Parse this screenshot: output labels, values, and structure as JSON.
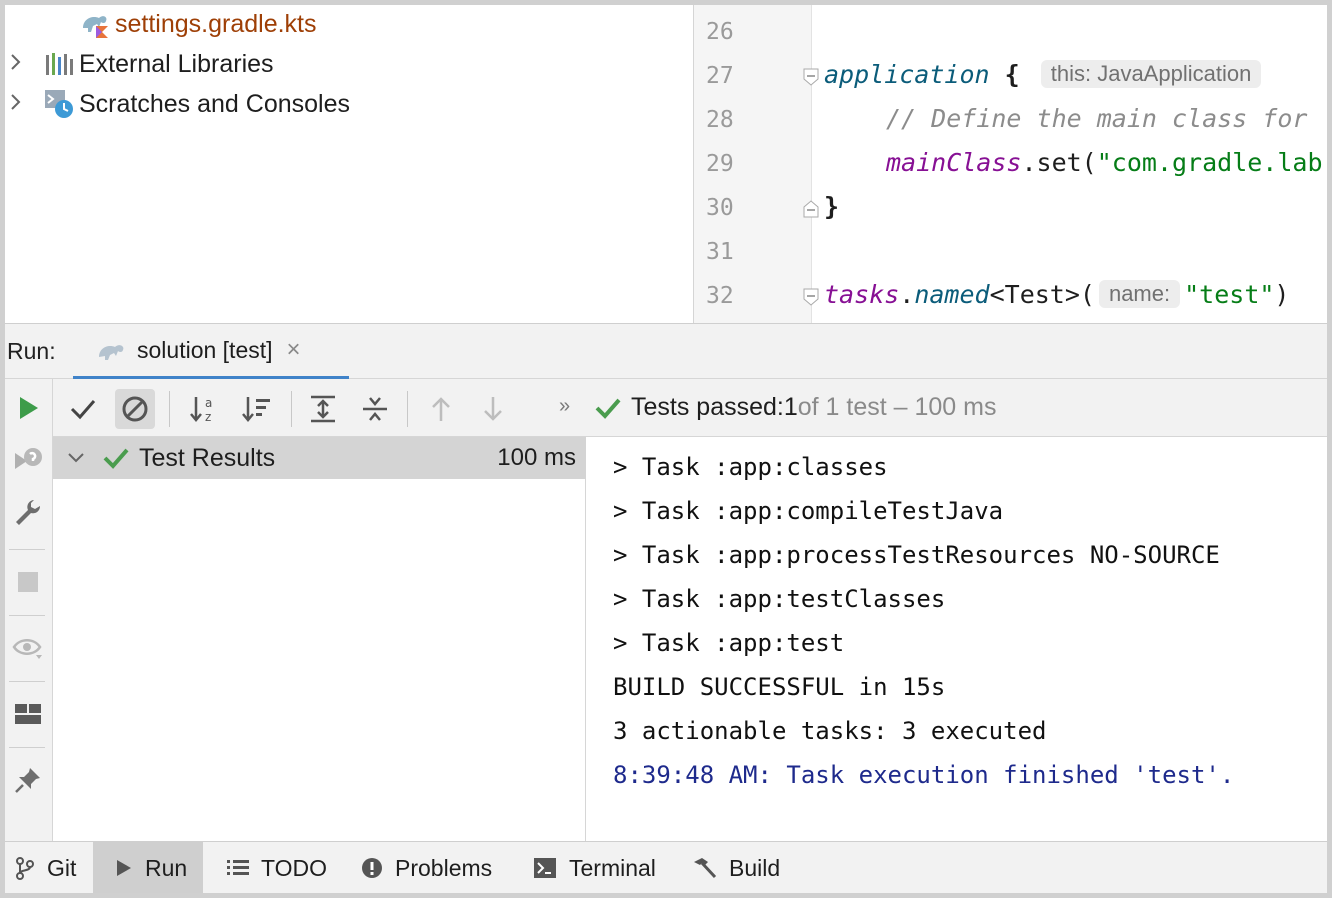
{
  "project_tree": {
    "items": [
      {
        "label": "settings.gradle.kts",
        "icon": "gradle-kotlin-file-icon"
      },
      {
        "label": "External Libraries",
        "icon": "libraries-icon"
      },
      {
        "label": "Scratches and Consoles",
        "icon": "scratches-icon"
      }
    ]
  },
  "editor": {
    "line_numbers": [
      "26",
      "27",
      "28",
      "29",
      "30",
      "31",
      "32"
    ],
    "line27": {
      "fn": "application",
      "brace": " {",
      "hint": "this: JavaApplication"
    },
    "line28": {
      "comment": "// Define the main class for"
    },
    "line29": {
      "prop": "mainClass",
      "method": ".set(",
      "str": "\"com.gradle.lab"
    },
    "line30": {
      "brace": "}"
    },
    "line32": {
      "obj": "tasks",
      "dot": ".",
      "fn": "named",
      "generic": "<Test>(",
      "hint": "name:",
      "str": "\"test\"",
      "close": ")"
    }
  },
  "run_panel": {
    "label": "Run:",
    "tab_title": "solution [test]",
    "tab_close": "×"
  },
  "test_toolbar": {
    "more": "»",
    "status_prefix": "Tests passed: ",
    "status_count": "1",
    "status_suffix": " of 1 test – 100 ms"
  },
  "test_tree": {
    "root_label": "Test Results",
    "root_time": "100 ms"
  },
  "console": {
    "lines": [
      "> Task :app:classes",
      "> Task :app:compileTestJava",
      "> Task :app:processTestResources NO-SOURCE",
      "> Task :app:testClasses",
      "> Task :app:test",
      "BUILD SUCCESSFUL in 15s",
      "3 actionable tasks: 3 executed",
      "8:39:48 AM: Task execution finished 'test'."
    ]
  },
  "bottom_bar": {
    "items": [
      {
        "label": "Git",
        "icon": "git-branch-icon"
      },
      {
        "label": "Run",
        "icon": "run-icon",
        "active": true
      },
      {
        "label": "TODO",
        "icon": "todo-list-icon"
      },
      {
        "label": "Problems",
        "icon": "problems-icon"
      },
      {
        "label": "Terminal",
        "icon": "terminal-icon"
      },
      {
        "label": "Build",
        "icon": "hammer-icon"
      }
    ]
  },
  "colors": {
    "success_green": "#4a9c4e",
    "run_green": "#3d9c4a",
    "tab_underline": "#4083c9",
    "console_blue": "#1e2a8c"
  }
}
